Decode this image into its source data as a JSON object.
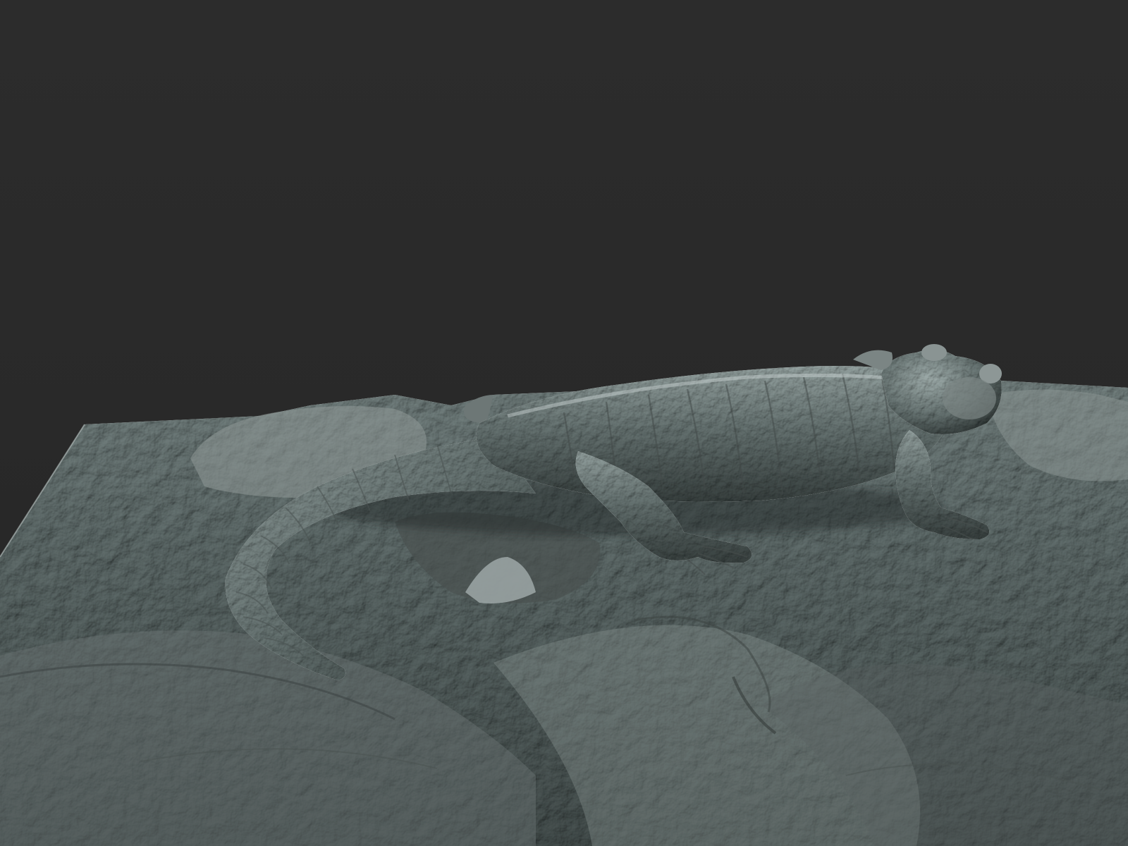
{
  "scene": {
    "background_color": "#2b2b2b",
    "material_color": "#7c8584",
    "highlight_color": "#c7d2d1",
    "shadow_color": "#1f2424",
    "subject": "salamander-sculpt-icon",
    "ground": "rock-terrain-slab-icon"
  }
}
